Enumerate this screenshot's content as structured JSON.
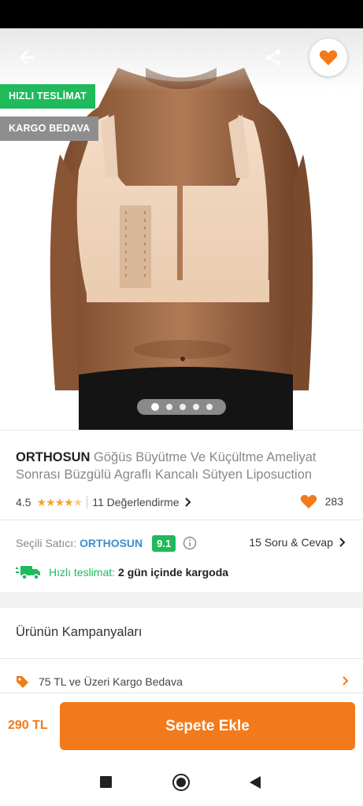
{
  "gallery": {
    "badges": {
      "fast_delivery": "HIZLI TESLİMAT",
      "free_cargo": "KARGO BEDAVA"
    },
    "pager": {
      "total": 5,
      "active_index": 0
    }
  },
  "product": {
    "brand": "ORTHOSUN",
    "title": "Göğüs Büyütme Ve Küçültme Ameliyat Sonrası Büzgülü Agraflı Kancalı Sütyen Liposuction",
    "rating": "4.5",
    "stars_value": 4.5,
    "reviews": "11 Değerlendirme",
    "favorites": "283"
  },
  "seller": {
    "label": "Seçili Satıcı:",
    "name": "ORTHOSUN",
    "score": "9.1",
    "qa": "15 Soru & Cevap"
  },
  "delivery": {
    "label": "Hızlı teslimat:",
    "text": "2 gün içinde kargoda"
  },
  "campaigns": {
    "title": "Ürünün Kampanyaları",
    "items": [
      {
        "label": "75 TL ve Üzeri Kargo Bedava"
      }
    ]
  },
  "bottom": {
    "price": "290 TL",
    "cart_label": "Sepete Ekle"
  },
  "colors": {
    "accent": "#f27a1a",
    "success": "#1fba5b",
    "link": "#3d8ecd",
    "badge_gray": "#8e8e8e"
  },
  "icons": [
    "back-arrow-icon",
    "share-icon",
    "heart-icon",
    "chevron-right-icon",
    "info-icon",
    "truck-icon",
    "tag-icon",
    "nav-recents-icon",
    "nav-home-icon",
    "nav-back-icon"
  ]
}
